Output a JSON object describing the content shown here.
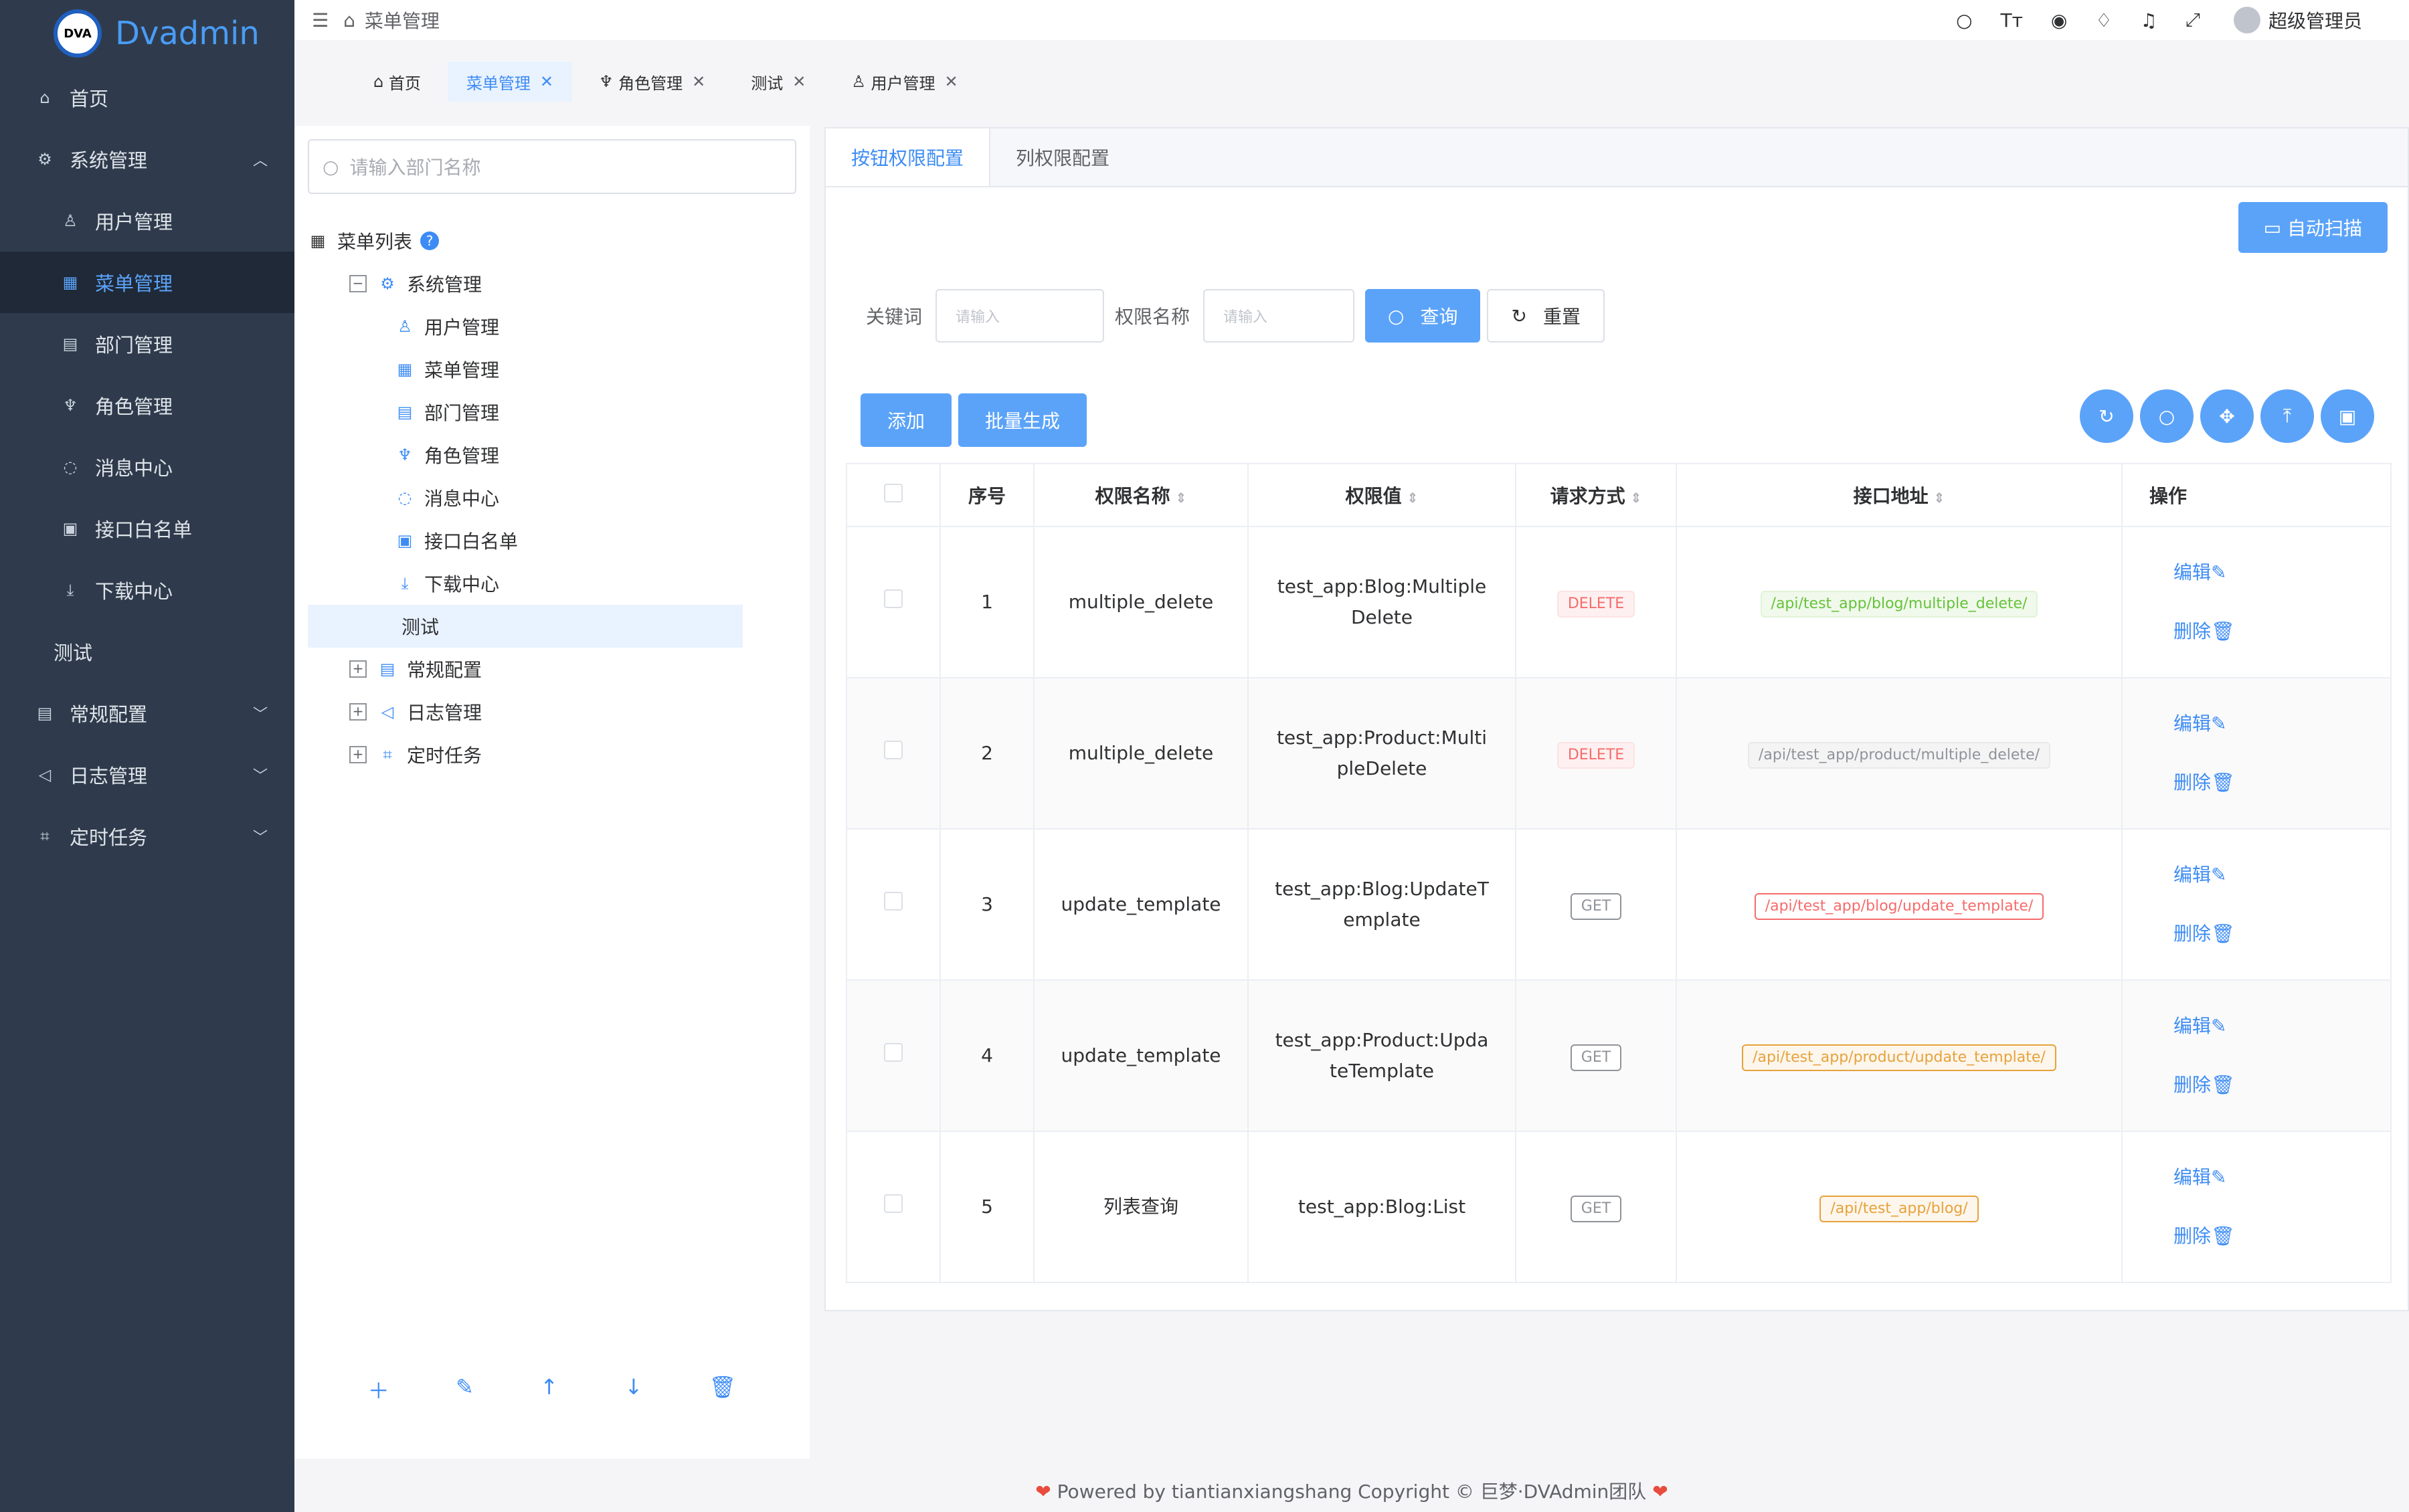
{
  "brand": {
    "logo_text": "DVA",
    "name": "Dvadmin"
  },
  "sidebar": {
    "items": [
      {
        "label": "首页",
        "icon": "home-icon"
      },
      {
        "label": "系统管理",
        "icon": "gear-icon"
      },
      {
        "label": "用户管理",
        "icon": "user-icon"
      },
      {
        "label": "菜单管理",
        "icon": "grid-icon"
      },
      {
        "label": "部门管理",
        "icon": "building-icon"
      },
      {
        "label": "角色管理",
        "icon": "role-icon"
      },
      {
        "label": "消息中心",
        "icon": "message-icon"
      },
      {
        "label": "接口白名单",
        "icon": "whitelist-icon"
      },
      {
        "label": "下载中心",
        "icon": "download-icon"
      },
      {
        "label": "测试",
        "icon": ""
      },
      {
        "label": "常规配置",
        "icon": "config-icon"
      },
      {
        "label": "日志管理",
        "icon": "log-icon"
      },
      {
        "label": "定时任务",
        "icon": "crop-icon"
      }
    ]
  },
  "header": {
    "breadcrumb": "菜单管理",
    "user": "超级管理员"
  },
  "tabs": [
    {
      "label": "首页"
    },
    {
      "label": "菜单管理"
    },
    {
      "label": "角色管理"
    },
    {
      "label": "测试"
    },
    {
      "label": "用户管理"
    }
  ],
  "tree": {
    "search_placeholder": "请输入部门名称",
    "root": "菜单列表",
    "help": "?",
    "nodes": [
      {
        "label": "系统管理"
      },
      {
        "label": "用户管理"
      },
      {
        "label": "菜单管理"
      },
      {
        "label": "部门管理"
      },
      {
        "label": "角色管理"
      },
      {
        "label": "消息中心"
      },
      {
        "label": "接口白名单"
      },
      {
        "label": "下载中心"
      },
      {
        "label": "测试"
      },
      {
        "label": "常规配置"
      },
      {
        "label": "日志管理"
      },
      {
        "label": "定时任务"
      }
    ]
  },
  "panel": {
    "tabs": [
      "按钮权限配置",
      "列权限配置"
    ],
    "auto_scan": "自动扫描",
    "filter": {
      "keyword_label": "关键词",
      "keyword_placeholder": "请输入",
      "name_label": "权限名称",
      "name_placeholder": "请输入",
      "query": "查询",
      "reset": "重置"
    },
    "add": "添加",
    "batch": "批量生成",
    "columns": [
      "序号",
      "权限名称",
      "权限值",
      "请求方式",
      "接口地址",
      "操作"
    ],
    "rows": [
      {
        "no": "1",
        "name": "multiple_delete",
        "value": "test_app:Blog:MultipleDelete",
        "method": "DELETE",
        "path": "/api/test_app/blog/multiple_delete/"
      },
      {
        "no": "2",
        "name": "multiple_delete",
        "value": "test_app:Product:MultipleDelete",
        "method": "DELETE",
        "path": "/api/test_app/product/multiple_delete/"
      },
      {
        "no": "3",
        "name": "update_template",
        "value": "test_app:Blog:UpdateTemplate",
        "method": "GET",
        "path": "/api/test_app/blog/update_template/"
      },
      {
        "no": "4",
        "name": "update_template",
        "value": "test_app:Product:UpdateTemplate",
        "method": "GET",
        "path": "/api/test_app/product/update_template/"
      },
      {
        "no": "5",
        "name": "列表查询",
        "value": "test_app:Blog:List",
        "method": "GET",
        "path": "/api/test_app/blog/"
      }
    ],
    "edit": "编辑",
    "delete": "删除"
  },
  "footer": {
    "text": "Powered by tiantianxiangshang Copyright © 巨梦·DVAdmin团队"
  }
}
